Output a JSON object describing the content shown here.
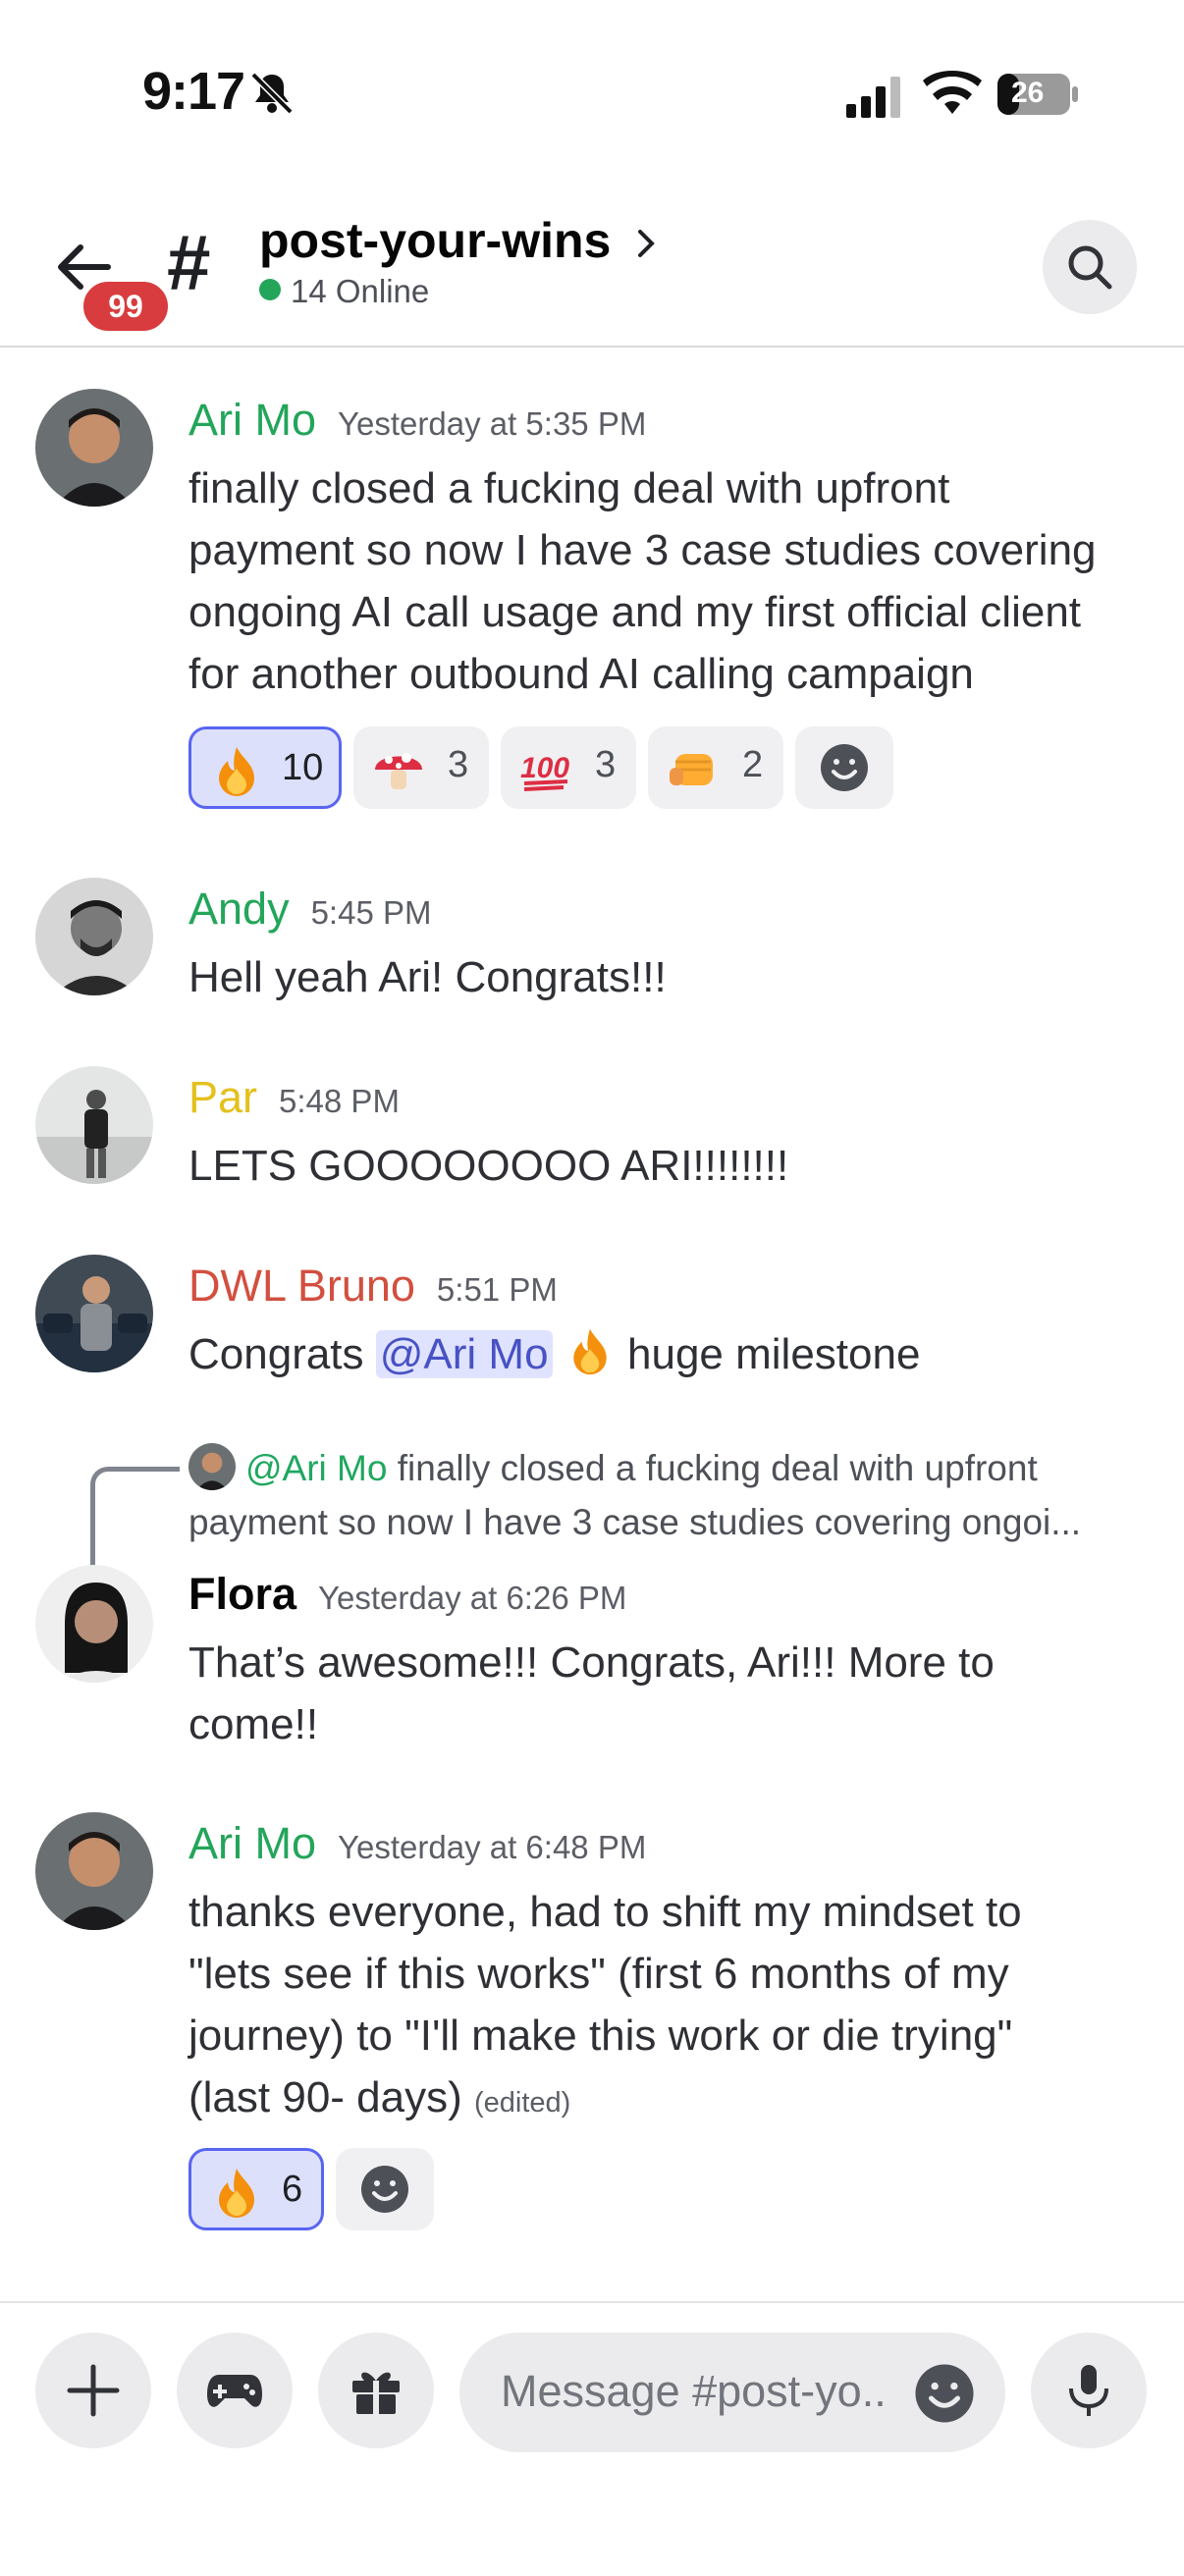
{
  "status_bar": {
    "time": "9:17",
    "battery": "26"
  },
  "header": {
    "back_badge": "99",
    "hash": "#",
    "channel_name": "post-your-wins",
    "online": "14 Online"
  },
  "messages": [
    {
      "username": "Ari Mo",
      "username_color": "#23a55a",
      "timestamp": "Yesterday at 5:35 PM",
      "lines": [
        "finally closed a fucking deal with upfront",
        "payment so now I have 3 case studies covering",
        "ongoing AI call usage and my first official client",
        "for another outbound AI calling campaign"
      ],
      "reactions": [
        {
          "emoji": "fire",
          "count": "10",
          "active": true
        },
        {
          "emoji": "mushroom",
          "count": "3",
          "active": false
        },
        {
          "emoji": "hundred",
          "count": "3",
          "active": false
        },
        {
          "emoji": "fist",
          "count": "2",
          "active": false
        }
      ]
    },
    {
      "username": "Andy",
      "username_color": "#23a55a",
      "timestamp": "5:45 PM",
      "text": "Hell yeah Ari! Congrats!!!"
    },
    {
      "username": "Par",
      "username_color": "#e5c01c",
      "timestamp": "5:48 PM",
      "text": "LETS GOOOOOOOO ARI!!!!!!!!"
    },
    {
      "username": "DWL Bruno",
      "username_color": "#d24f3f",
      "timestamp": "5:51 PM",
      "text_before": "Congrats ",
      "mention": "@Ari Mo",
      "text_after": " huge milestone"
    },
    {
      "reply": {
        "mention": "@Ari Mo",
        "line1": " finally closed a fucking deal with upfront",
        "line2": "payment so now I have 3 case studies covering ongoi..."
      },
      "username": "Flora",
      "username_color": "#060607",
      "timestamp": "Yesterday at 6:26 PM",
      "lines": [
        "That’s awesome!!! Congrats, Ari!!!  More to",
        "come!!"
      ]
    },
    {
      "username": "Ari Mo",
      "username_color": "#23a55a",
      "timestamp": "Yesterday at 6:48 PM",
      "lines": [
        "thanks everyone, had to shift my mindset to",
        "\"lets see if this works\" (first 6 months of my",
        "journey) to \"I'll make this work or die trying\"",
        "(last 90- days)"
      ],
      "edited": "(edited)",
      "reactions": [
        {
          "emoji": "fire",
          "count": "6",
          "active": true
        }
      ]
    }
  ],
  "composer": {
    "placeholder": "Message #post-yo.."
  },
  "colors": {
    "accent": "#5865f2",
    "online": "#23a55a",
    "badge": "#d83c3e"
  }
}
